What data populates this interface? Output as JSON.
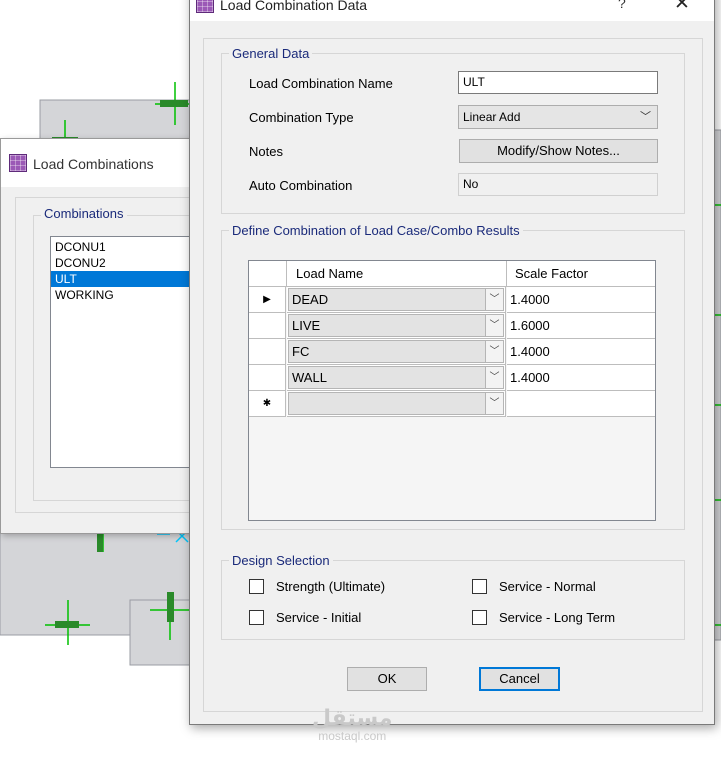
{
  "background_window": {
    "title": "Load Combinations",
    "group_label": "Combinations",
    "items": [
      "DCONU1",
      "DCONU2",
      "ULT",
      "WORKING"
    ],
    "selected_item": "ULT"
  },
  "dialog": {
    "title": "Load Combination Data",
    "help_label": "?",
    "close_label": "X",
    "general": {
      "group_label": "General Data",
      "name_label": "Load Combination Name",
      "name_value": "ULT",
      "type_label": "Combination Type",
      "type_value": "Linear Add",
      "notes_label": "Notes",
      "notes_button": "Modify/Show Notes...",
      "auto_label": "Auto Combination",
      "auto_value": "No"
    },
    "define": {
      "group_label": "Define Combination of Load Case/Combo Results",
      "col_load": "Load Name",
      "col_factor": "Scale Factor",
      "rows": [
        {
          "marker": "▶",
          "load": "DEAD",
          "factor": "1.4000"
        },
        {
          "marker": "",
          "load": "LIVE",
          "factor": "1.6000"
        },
        {
          "marker": "",
          "load": "FC",
          "factor": "1.4000"
        },
        {
          "marker": "",
          "load": "WALL",
          "factor": "1.4000"
        },
        {
          "marker": "✱",
          "load": "",
          "factor": ""
        }
      ]
    },
    "design": {
      "group_label": "Design Selection",
      "strength": "Strength (Ultimate)",
      "service_normal": "Service - Normal",
      "service_initial": "Service - Initial",
      "service_long": "Service - Long Term"
    },
    "ok_label": "OK",
    "cancel_label": "Cancel"
  },
  "watermark": {
    "arabic": "مستقل",
    "latin": "mostaql.com"
  },
  "colors": {
    "accent": "#0078d7",
    "group_label": "#1a2a7a",
    "cad_green": "#00c000"
  }
}
